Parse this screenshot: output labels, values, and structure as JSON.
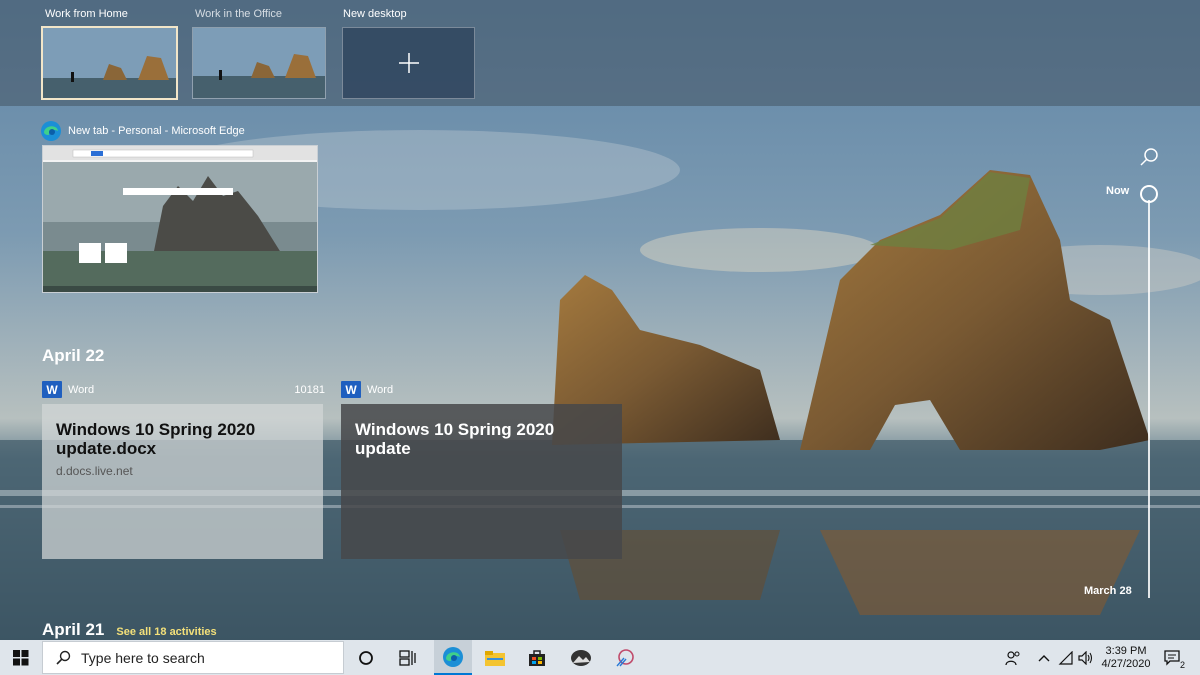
{
  "desktops": [
    {
      "label": "Work from Home",
      "active": true
    },
    {
      "label": "Work in the Office",
      "active": false
    },
    {
      "label": "New desktop",
      "active": false
    }
  ],
  "window": {
    "title": "New tab - Personal - Microsoft Edge",
    "icon": "edge-icon"
  },
  "timeline": {
    "now_label": "Now",
    "end_label": "March 28",
    "groups": [
      {
        "date": "April 22",
        "activities": [
          {
            "app": "Word",
            "count": "10181",
            "title": "Windows 10 Spring 2020 update.docx",
            "subtitle": "d.docs.live.net"
          },
          {
            "app": "Word",
            "count": "",
            "title": "Windows 10 Spring 2020 update",
            "subtitle": ""
          }
        ]
      },
      {
        "date": "April 21",
        "see_all": "See all 18 activities"
      }
    ]
  },
  "taskbar": {
    "search_placeholder": "Type here to search",
    "apps": [
      "cortana-icon",
      "task-view-icon",
      "edge-icon",
      "file-explorer-icon",
      "store-icon",
      "photos-icon",
      "snip-icon"
    ],
    "time": "3:39 PM",
    "date": "4/27/2020",
    "notification_count": "2"
  },
  "colors": {
    "accent": "#0078d4",
    "word_blue": "#1f5fbf",
    "taskbar_bg": "#dfe5eb"
  }
}
